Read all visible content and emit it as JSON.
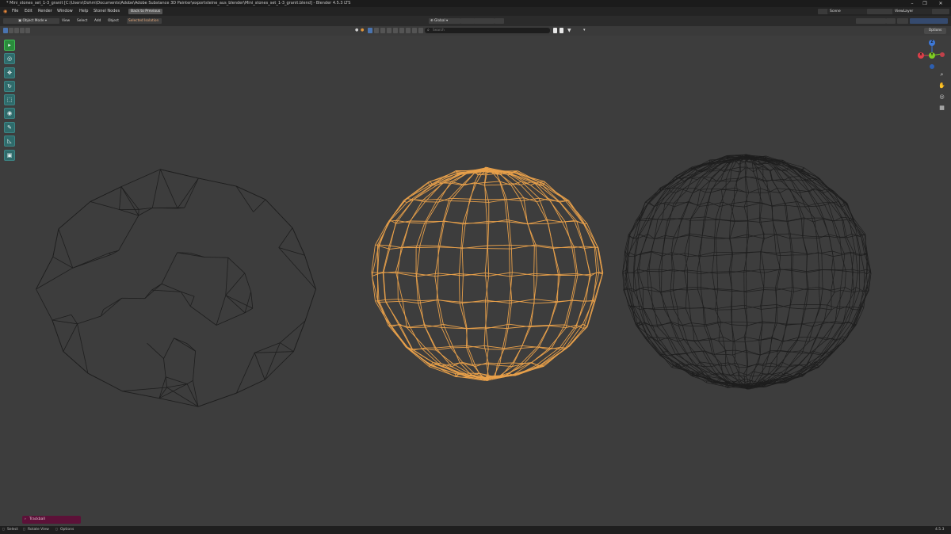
{
  "titlebar": {
    "title": "* Mini_stones_set_1-3_granit [C:\\Users\\Oohm\\Documents\\Adobe\\Adobe Substance 3D Painter\\exportsteine_aus_blender\\Mini_stones_set_1-3_granit.blend] - Blender 4.5.3 LTS",
    "minimize": "–",
    "maximize": "❐",
    "close": "✕"
  },
  "menubar": {
    "items": [
      "File",
      "Edit",
      "Render",
      "Window",
      "Help",
      "Stonel Nodes"
    ],
    "back_button": "Back to Previous",
    "scene_label": "Scene",
    "viewlayer_label": "ViewLayer"
  },
  "header": {
    "mode": "Object Mode",
    "menus": [
      "View",
      "Select",
      "Add",
      "Object"
    ],
    "selection_filter": "Selected Isolation",
    "transform_orientation": "Global",
    "options": "Options"
  },
  "viewport_header": {
    "search_placeholder": "Search"
  },
  "gizmo": {
    "x": "X",
    "y": "Y",
    "z": "Z",
    "colors": {
      "x": "#e0404a",
      "y": "#7ecf22",
      "z": "#3d78d8"
    }
  },
  "operator_panel": {
    "label": "Trackball"
  },
  "statusbar": {
    "select": "Select",
    "rotate_view": "Rotate View",
    "object": "Options",
    "version": "4.5.3"
  },
  "colors": {
    "viewport_bg": "#3d3d3d",
    "wire_unselected": "#1e1e1e",
    "wire_selected": "#e8a04a"
  },
  "icons": [
    "blender-logo-icon",
    "select-box-icon",
    "cursor-icon",
    "move-icon",
    "rotate-icon",
    "scale-icon",
    "transform-icon",
    "annotate-icon",
    "measure-icon",
    "add-cube-icon",
    "zoom-icon",
    "pan-hand-icon",
    "camera-icon",
    "grid-icon"
  ]
}
